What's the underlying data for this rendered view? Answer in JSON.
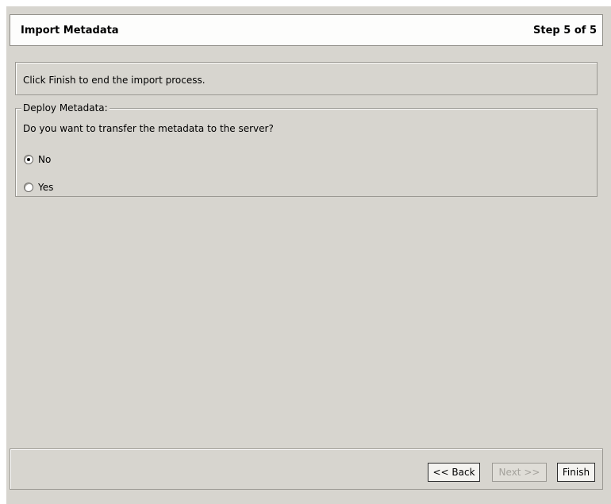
{
  "header": {
    "title": "Import Metadata",
    "step": "Step 5 of 5"
  },
  "info": {
    "text": "Click Finish to end the import process."
  },
  "deploy": {
    "legend": "Deploy Metadata:",
    "question": "Do you want to transfer the metadata to the server?",
    "options": [
      {
        "label": "No",
        "selected": true
      },
      {
        "label": "Yes",
        "selected": false
      }
    ]
  },
  "buttons": {
    "back": "<< Back",
    "next": "Next >>",
    "finish": "Finish"
  }
}
